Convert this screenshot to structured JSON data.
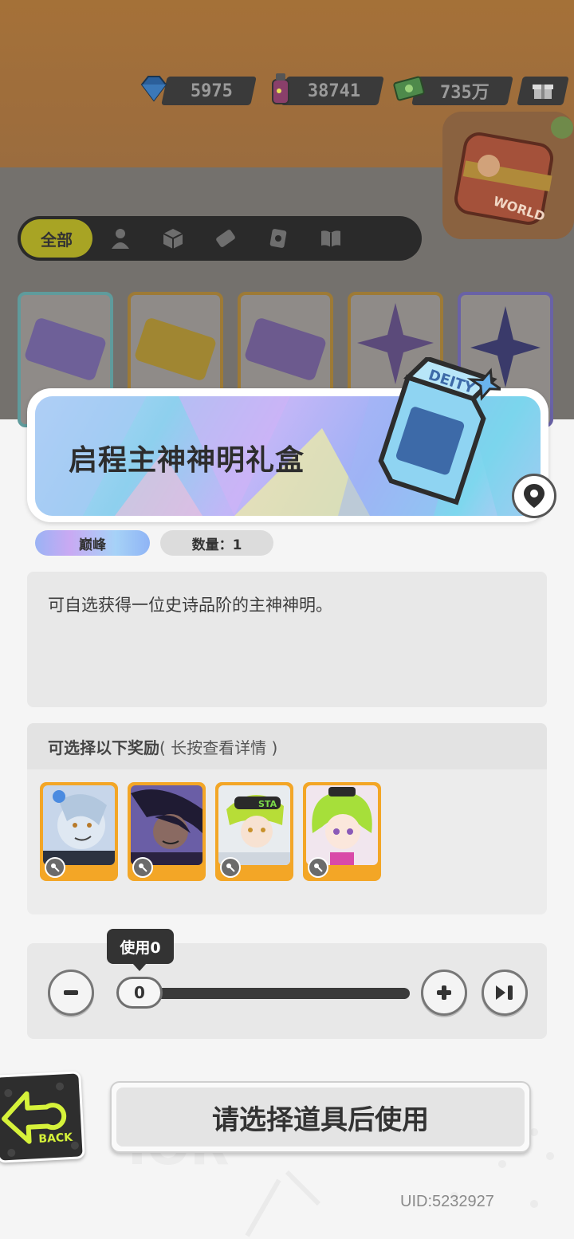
{
  "resources": [
    {
      "icon": "diamond-icon",
      "value": "5975"
    },
    {
      "icon": "spray-can-icon",
      "value": "38741"
    },
    {
      "icon": "cash-icon",
      "value": "735万"
    }
  ],
  "category_tabs": {
    "active_label": "全部",
    "icons": [
      "person-icon",
      "box-icon",
      "ticket-icon",
      "card-icon",
      "book-icon"
    ]
  },
  "item": {
    "name": "启程主神神明礼盒",
    "rarity": "巅峰",
    "quantity_label": "数量：1",
    "description": "可自选获得一位史诗品阶的主神神明。"
  },
  "rewards": {
    "header": "可选择以下奖励",
    "hint": "( 长按查看详情 )",
    "count": 4
  },
  "slider": {
    "tooltip": "使用0",
    "value": "0"
  },
  "use_button": "请选择道具后使用",
  "back_label": "BACK",
  "uid": "UID:5232927",
  "colors": {
    "accent_orange": "#f3a626",
    "active_tab": "#a8a424",
    "back_neon": "#d6f23a"
  }
}
